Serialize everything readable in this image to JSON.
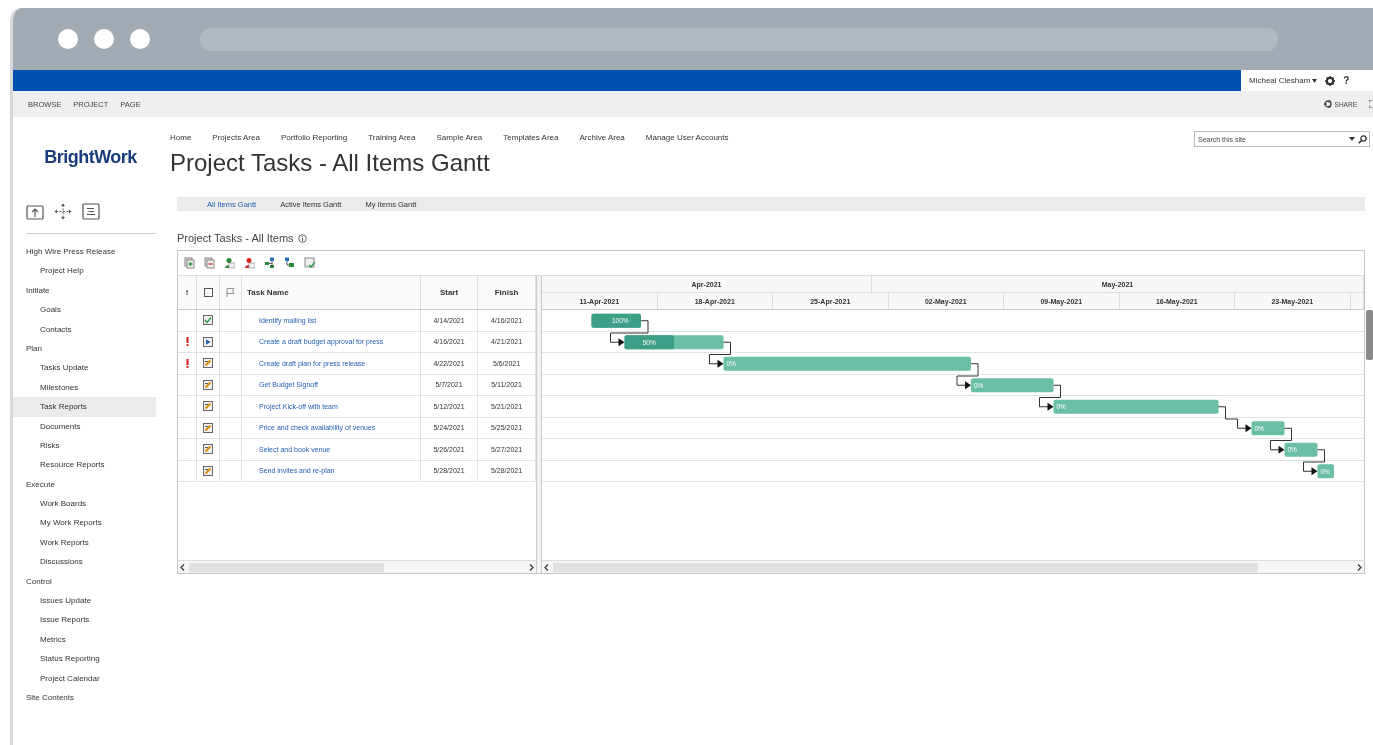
{
  "suite_bar": {
    "user": "Micheal Clesham",
    "help": "?"
  },
  "ribbon": {
    "tabs": [
      {
        "label": "BROWSE"
      },
      {
        "label": "PROJECT"
      },
      {
        "label": "PAGE"
      }
    ],
    "share": "SHARE"
  },
  "logo": "BrightWork",
  "top_nav": [
    "Home",
    "Projects Area",
    "Portfolio Reporting",
    "Training Area",
    "Sample Area",
    "Templates Area",
    "Archive Area",
    "Manage User Accounts"
  ],
  "search": {
    "placeholder": "Search this site"
  },
  "page_title": "Project Tasks - All Items Gantt",
  "sidebar": {
    "items": [
      {
        "label": "High Wire Press Release",
        "selected": false,
        "children": [
          {
            "label": "Project Help",
            "selected": false
          }
        ]
      },
      {
        "label": "Initiate",
        "selected": false,
        "children": [
          {
            "label": "Goals",
            "selected": false
          },
          {
            "label": "Contacts",
            "selected": false
          }
        ]
      },
      {
        "label": "Plan",
        "selected": false,
        "children": [
          {
            "label": "Tasks Update",
            "selected": false
          },
          {
            "label": "Milestones",
            "selected": false
          },
          {
            "label": "Task Reports",
            "selected": true
          },
          {
            "label": "Documents",
            "selected": false
          },
          {
            "label": "Risks",
            "selected": false
          },
          {
            "label": "Resource Reports",
            "selected": false
          }
        ]
      },
      {
        "label": "Execute",
        "selected": false,
        "children": [
          {
            "label": "Work Boards",
            "selected": false
          },
          {
            "label": "My Work Reports",
            "selected": false
          },
          {
            "label": "Work Reports",
            "selected": false
          },
          {
            "label": "Discussions",
            "selected": false
          }
        ]
      },
      {
        "label": "Control",
        "selected": false,
        "children": [
          {
            "label": "Issues Update",
            "selected": false
          },
          {
            "label": "Issue Reports",
            "selected": false
          },
          {
            "label": "Metrics",
            "selected": false
          },
          {
            "label": "Status Reporting",
            "selected": false
          },
          {
            "label": "Project Calendar",
            "selected": false
          }
        ]
      },
      {
        "label": "Site Contents",
        "selected": false
      }
    ]
  },
  "view_tabs": [
    {
      "label": "All Items Gantt",
      "selected": true
    },
    {
      "label": "Active Items Gantt",
      "selected": false
    },
    {
      "label": "My Items Gantt",
      "selected": false
    }
  ],
  "list_title": "Project Tasks - All Items",
  "grid": {
    "columns": [
      {
        "kind": "priority",
        "label": "!"
      },
      {
        "kind": "status"
      },
      {
        "kind": "flag"
      },
      {
        "kind": "name",
        "label": "Task Name"
      },
      {
        "kind": "start",
        "label": "Start"
      },
      {
        "kind": "finish",
        "label": "Finish"
      }
    ],
    "rows": [
      {
        "high_priority": false,
        "kind": "completed",
        "task": "Identify mailing list",
        "start": "4/14/2021",
        "finish": "4/16/2021",
        "progress": "100%",
        "depends_on_previous": false
      },
      {
        "high_priority": true,
        "kind": "in_progress",
        "task": "Create a draft budget approval for press",
        "start": "4/16/2021",
        "finish": "4/21/2021",
        "progress": "50%",
        "depends_on_previous": true
      },
      {
        "high_priority": true,
        "kind": "not_started",
        "task": "Create draft plan for press release",
        "start": "4/22/2021",
        "finish": "5/6/2021",
        "progress": "0%",
        "depends_on_previous": true
      },
      {
        "high_priority": false,
        "kind": "not_started",
        "task": "Get Budget Signoff",
        "start": "5/7/2021",
        "finish": "5/11/2021",
        "progress": "0%",
        "depends_on_previous": true
      },
      {
        "high_priority": false,
        "kind": "not_started",
        "task": "Project Kick-off with team",
        "start": "5/12/2021",
        "finish": "5/21/2021",
        "progress": "0%",
        "depends_on_previous": true
      },
      {
        "high_priority": false,
        "kind": "not_started",
        "task": "Price and check availability of venues",
        "start": "5/24/2021",
        "finish": "5/25/2021",
        "progress": "0%",
        "depends_on_previous": true
      },
      {
        "high_priority": false,
        "kind": "not_started",
        "task": "Select and book venue",
        "start": "5/26/2021",
        "finish": "5/27/2021",
        "progress": "0%",
        "depends_on_previous": true
      },
      {
        "high_priority": false,
        "kind": "not_started",
        "task": "Send invites and re-plan",
        "start": "5/28/2021",
        "finish": "5/28/2021",
        "progress": "0%",
        "depends_on_previous": true
      }
    ]
  },
  "timeline": {
    "months": [
      {
        "label": "Apr-2021"
      },
      {
        "label": "May-2021"
      }
    ],
    "weeks": [
      "11-Apr-2021",
      "18-Apr-2021",
      "25-Apr-2021",
      "02-May-2021",
      "09-May-2021",
      "16-May-2021",
      "23-May-2021"
    ]
  }
}
